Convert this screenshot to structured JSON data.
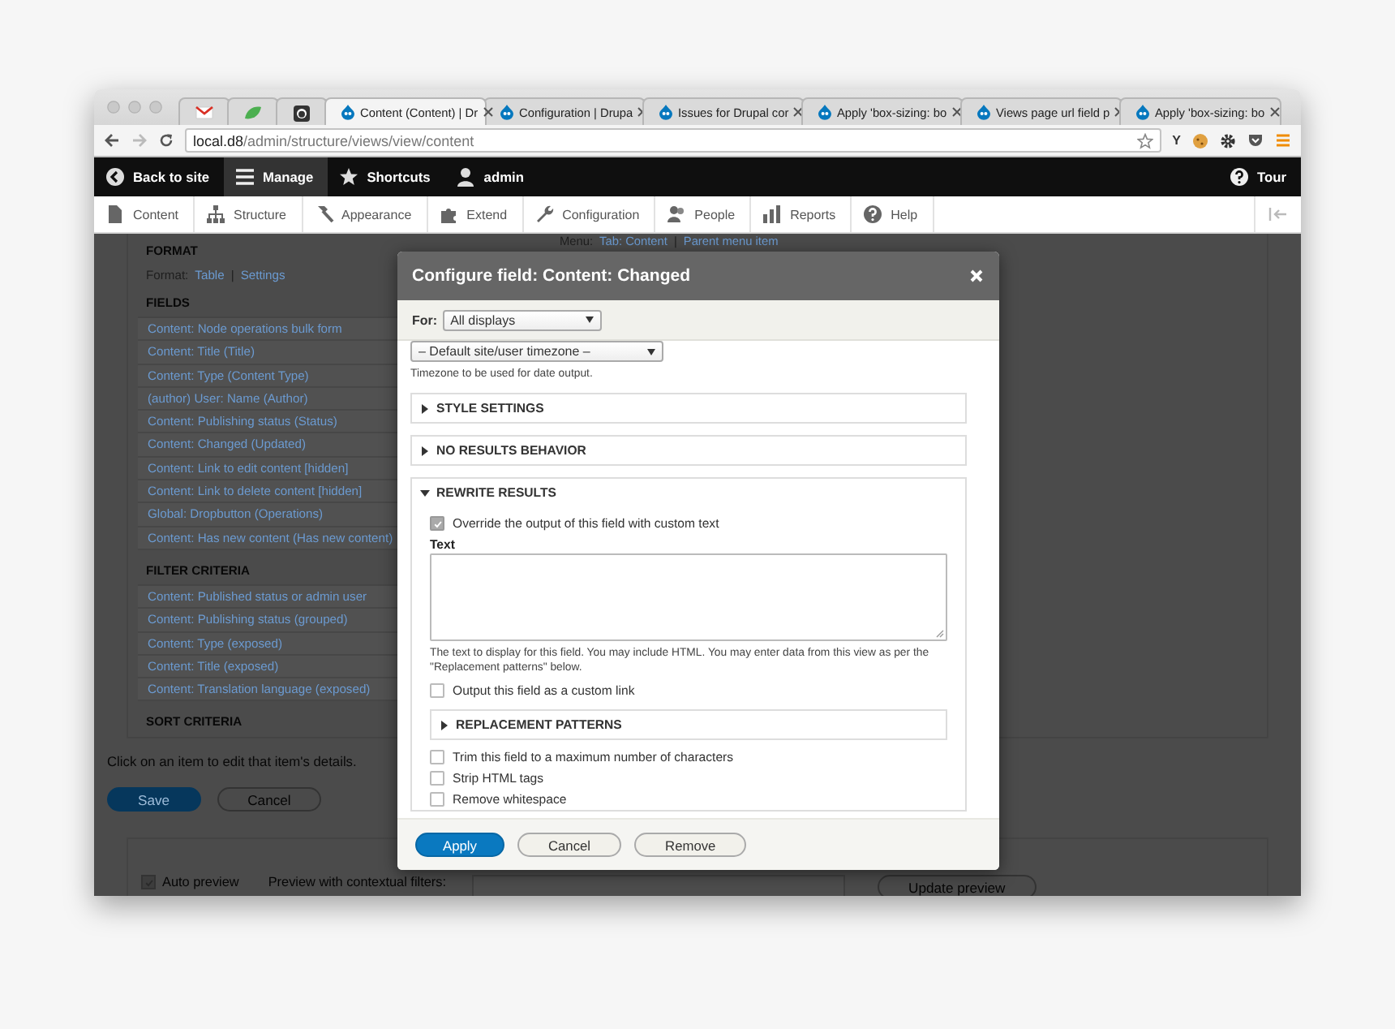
{
  "browser": {
    "tabs": [
      {
        "label": "Content (Content) | Dr",
        "selected": true
      },
      {
        "label": "Configuration | Drupa",
        "selected": false
      },
      {
        "label": "Issues for Drupal cor",
        "selected": false
      },
      {
        "label": "Apply 'box-sizing: bo",
        "selected": false
      },
      {
        "label": "Views page url field p",
        "selected": false
      },
      {
        "label": "Apply 'box-sizing: bo",
        "selected": false
      }
    ],
    "address": {
      "host": "local.d8",
      "path": "/admin/structure/views/view/content"
    },
    "extension_label": "Y"
  },
  "toolbar": {
    "items": [
      {
        "label": "Back to site",
        "selected": false
      },
      {
        "label": "Manage",
        "selected": true
      },
      {
        "label": "Shortcuts",
        "selected": false
      },
      {
        "label": "admin",
        "selected": false
      }
    ],
    "tour": "Tour"
  },
  "tray": {
    "items": [
      "Content",
      "Structure",
      "Appearance",
      "Extend",
      "Configuration",
      "People",
      "Reports",
      "Help"
    ]
  },
  "view": {
    "menu": {
      "label": "Menu:",
      "links": [
        "Tab: Content",
        "Parent menu item"
      ],
      "separator": "|"
    },
    "format": {
      "title": "FORMAT",
      "label": "Format:",
      "links": [
        "Table",
        "Settings"
      ],
      "separator": "|"
    },
    "fields": {
      "title": "FIELDS",
      "items": [
        "Content: Node operations bulk form",
        "Content: Title (Title)",
        "Content: Type (Content Type)",
        "(author) User: Name (Author)",
        "Content: Publishing status (Status)",
        "Content: Changed (Updated)",
        "Content: Link to edit content [hidden]",
        "Content: Link to delete content [hidden]",
        "Global: Dropbutton (Operations)",
        "Content: Has new content (Has new content)"
      ]
    },
    "filters": {
      "title": "FILTER CRITERIA",
      "items": [
        "Content: Published status or admin user",
        "Content: Publishing status (grouped)",
        "Content: Type (exposed)",
        "Content: Title (exposed)",
        "Content: Translation language (exposed)"
      ]
    },
    "sort": {
      "title": "SORT CRITERIA"
    },
    "hint": "Click on an item to edit that item's details.",
    "buttons": [
      {
        "label": "Save",
        "kind": "primary"
      },
      {
        "label": "Cancel",
        "kind": "secondary"
      }
    ],
    "preview": {
      "auto": {
        "label": "Auto preview",
        "checked": true
      },
      "contextual_label": "Preview with contextual filters:",
      "button": "Update preview"
    }
  },
  "dialog": {
    "title": "Configure field: Content: Changed",
    "for": {
      "label": "For:",
      "value": "All displays"
    },
    "timezone": {
      "value": "– Default site/user timezone –",
      "help": "Timezone to be used for date output."
    },
    "sections": [
      {
        "title": "STYLE SETTINGS",
        "expanded": false
      },
      {
        "title": "NO RESULTS BEHAVIOR",
        "expanded": false
      },
      {
        "title": "REWRITE RESULTS",
        "expanded": true
      }
    ],
    "rewrite": {
      "override": {
        "label": "Override the output of this field with custom text",
        "checked": true
      },
      "text_label": "Text",
      "text_help": "The text to display for this field. You may include HTML. You may enter data from this view as per the \"Replacement patterns\" below.",
      "options": [
        {
          "kind": "checkbox",
          "label": "Output this field as a custom link",
          "checked": false
        },
        {
          "kind": "details",
          "label": "REPLACEMENT PATTERNS",
          "expanded": false
        },
        {
          "kind": "checkbox",
          "label": "Trim this field to a maximum number of characters",
          "checked": false
        },
        {
          "kind": "checkbox",
          "label": "Strip HTML tags",
          "checked": false
        },
        {
          "kind": "checkbox",
          "label": "Remove whitespace",
          "checked": false
        }
      ]
    },
    "buttons": [
      {
        "label": "Apply",
        "kind": "primary"
      },
      {
        "label": "Cancel",
        "kind": "secondary"
      },
      {
        "label": "Remove",
        "kind": "secondary"
      }
    ]
  }
}
